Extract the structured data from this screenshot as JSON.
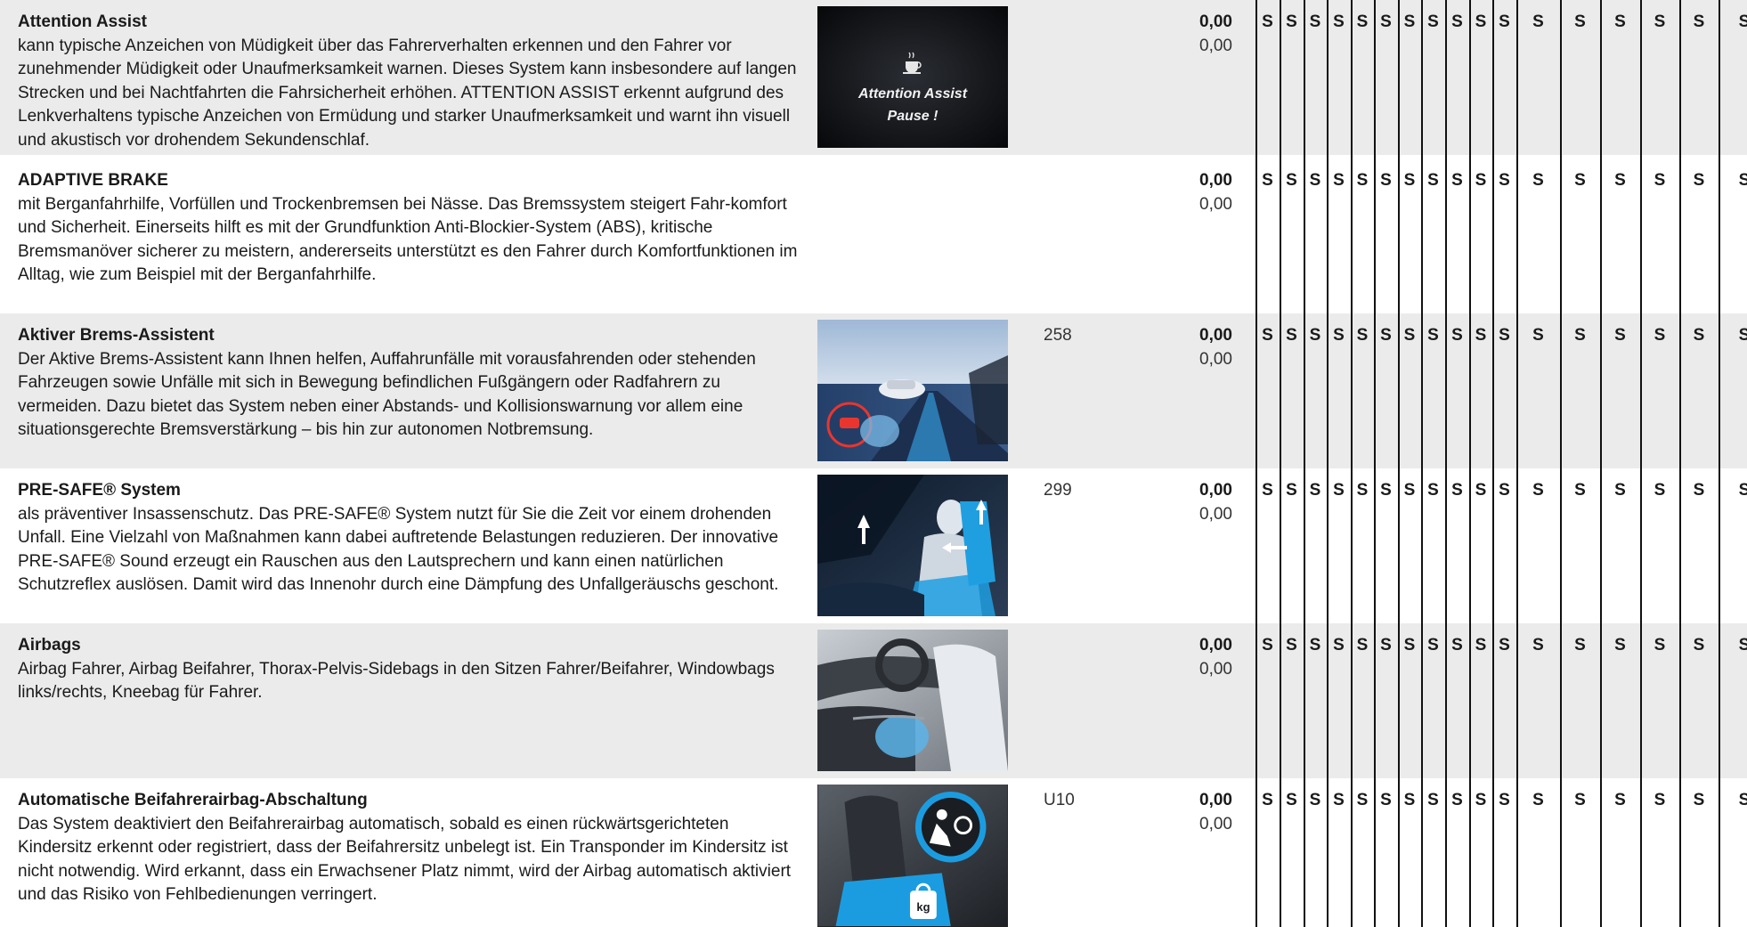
{
  "rows": [
    {
      "title": "Attention Assist",
      "text": "kann typische Anzeichen von Müdigkeit über das Fahrerverhalten erkennen und den Fahrer vor zunehmender Müdigkeit oder Unaufmerksamkeit warnen. Dieses System kann insbesondere auf langen Strecken und bei Nachtfahrten die Fahrsicherheit erhöhen. ATTENTION ASSIST erkennt aufgrund des Lenkverhaltens typische Anzeichen von Ermüdung und starker Unaufmerksamkeit und warnt ihn visuell und akustisch vor drohendem Sekundenschlaf.",
      "image": {
        "icon": "coffee-cup-icon",
        "line1": "Attention Assist",
        "line2": "Pause !"
      },
      "code": "",
      "price1": "0,00",
      "price2": "0,00"
    },
    {
      "title": "ADAPTIVE BRAKE",
      "text": "mit Berganfahrhilfe, Vorfüllen und Trockenbremsen bei Nässe. Das Bremssystem steigert Fahr-komfort und Sicherheit. Einerseits hilft es mit der Grundfunktion Anti-Blockier-System (ABS), kritische Bremsmanöver sicherer zu meistern, andererseits unterstützt es den Fahrer durch Komfortfunktionen im Alltag, wie zum Beispiel mit der Berganfahrhilfe.",
      "code": "",
      "price1": "0,00",
      "price2": "0,00"
    },
    {
      "title": "Aktiver Brems-Assistent",
      "text": "Der Aktive Brems-Assistent kann Ihnen helfen, Auffahrunfälle mit vorausfahrenden oder stehenden Fahrzeugen sowie Unfälle mit sich in Bewegung befindlichen Fußgängern oder Radfahrern zu vermeiden. Dazu bietet das System neben einer Abstands- und Kollisionswarnung vor allem eine situationsgerechte Bremsverstärkung – bis hin zur autonomen Notbremsung.",
      "code": "258",
      "price1": "0,00",
      "price2": "0,00"
    },
    {
      "title": "PRE-SAFE® System",
      "text": "als präventiver Insassenschutz. Das PRE-SAFE® System nutzt für Sie die Zeit vor einem drohenden Unfall. Eine Vielzahl von Maßnahmen kann dabei auftretende Belastungen reduzieren. Der innovative PRE-SAFE® Sound erzeugt ein Rauschen aus den Lautsprechern und kann einen natürlichen Schutzreflex auslösen. Damit wird das Innenohr durch eine Dämpfung des Unfallgeräuschs geschont.",
      "code": "299",
      "price1": "0,00",
      "price2": "0,00"
    },
    {
      "title": "Airbags",
      "text": "Airbag Fahrer, Airbag Beifahrer, Thorax-Pelvis-Sidebags in den Sitzen Fahrer/Beifahrer, Windowbags links/rechts, Kneebag für Fahrer.",
      "code": "",
      "price1": "0,00",
      "price2": "0,00"
    },
    {
      "title": "Automatische Beifahrerairbag-Abschaltung",
      "text": "Das System deaktiviert den Beifahrerairbag automatisch, sobald es einen rückwärtsgerichteten Kindersitz erkennt oder registriert, dass der Beifahrersitz unbelegt ist. Ein Transponder im Kindersitz ist nicht notwendig. Wird erkannt, dass ein Erwachsener Platz nimmt, wird der Airbag automatisch aktiviert und das Risiko von Fehlbedienungen verringert.",
      "image": {
        "icon": "airbag-icon",
        "badge": "kg"
      },
      "code": "U10",
      "price1": "0,00",
      "price2": "0,00"
    }
  ],
  "mark": "S",
  "mark_count": 18
}
